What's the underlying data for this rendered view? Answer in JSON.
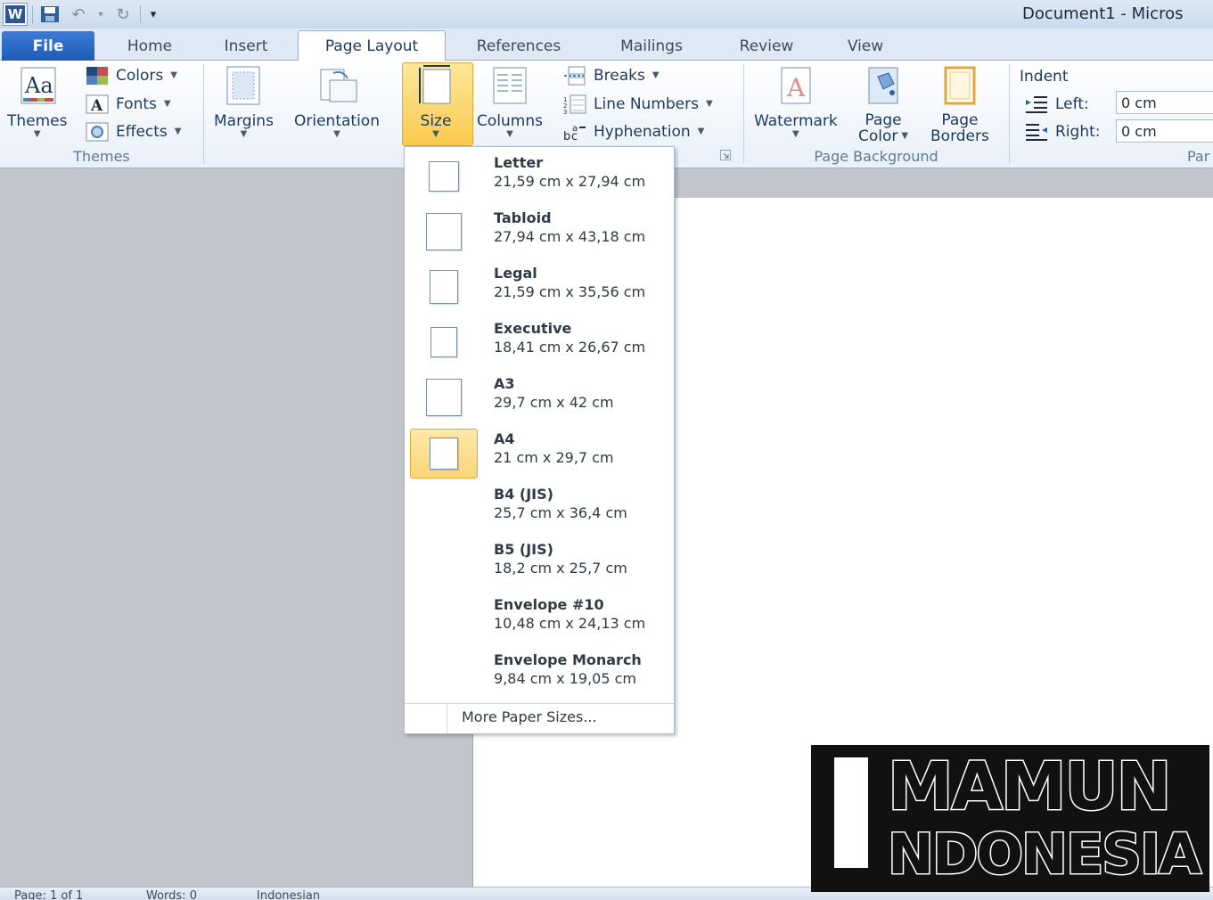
{
  "window": {
    "title": "Document1  -  Micros"
  },
  "qat": {
    "app_icon_letter": "W",
    "icons": [
      "save-icon",
      "undo-icon",
      "redo-icon",
      "customize-qat-icon"
    ]
  },
  "tabs": [
    {
      "label": "File"
    },
    {
      "label": "Home"
    },
    {
      "label": "Insert"
    },
    {
      "label": "Page Layout"
    },
    {
      "label": "References"
    },
    {
      "label": "Mailings"
    },
    {
      "label": "Review"
    },
    {
      "label": "View"
    }
  ],
  "ribbon": {
    "themes": {
      "themes_label": "Themes",
      "colors_label": "Colors",
      "fonts_label": "Fonts",
      "effects_label": "Effects",
      "group_label": "Themes"
    },
    "page_setup": {
      "margins_label": "Margins",
      "orientation_label": "Orientation",
      "size_label": "Size",
      "columns_label": "Columns",
      "breaks_label": "Breaks",
      "line_numbers_label": "Line Numbers",
      "hyphenation_label": "Hyphenation"
    },
    "page_background": {
      "watermark_label": "Watermark",
      "page_color_label_1": "Page",
      "page_color_label_2": "Color",
      "page_borders_label_1": "Page",
      "page_borders_label_2": "Borders",
      "group_label": "Page Background"
    },
    "paragraph": {
      "indent_label": "Indent",
      "left_label": "Left:",
      "left_value": "0 cm",
      "right_label": "Right:",
      "right_value": "0 cm",
      "group_label": "Par"
    }
  },
  "size_menu": {
    "items": [
      {
        "name": "Letter",
        "dims": "21,59 cm x 27,94 cm"
      },
      {
        "name": "Tabloid",
        "dims": "27,94 cm x 43,18 cm"
      },
      {
        "name": "Legal",
        "dims": "21,59 cm x 35,56 cm"
      },
      {
        "name": "Executive",
        "dims": "18,41 cm x 26,67 cm"
      },
      {
        "name": "A3",
        "dims": "29,7 cm x 42 cm"
      },
      {
        "name": "A4",
        "dims": "21 cm x 29,7 cm"
      },
      {
        "name": "B4 (JIS)",
        "dims": "25,7 cm x 36,4 cm"
      },
      {
        "name": "B5 (JIS)",
        "dims": "18,2 cm x 25,7 cm"
      },
      {
        "name": "Envelope #10",
        "dims": "10,48 cm x 24,13 cm"
      },
      {
        "name": "Envelope Monarch",
        "dims": "9,84 cm x 19,05 cm"
      }
    ],
    "selected": "A4",
    "more_label": "More Paper Sizes..."
  },
  "statusbar": {
    "page": "Page: 1 of 1",
    "words": "Words: 0",
    "language": "Indonesian"
  },
  "logo": {
    "line1": "MAMUN",
    "line2": "NDONESIA"
  },
  "colors": {
    "accent": "#2b579a",
    "file_tab": "#1c5cb8",
    "highlight": "#fbc94f"
  }
}
